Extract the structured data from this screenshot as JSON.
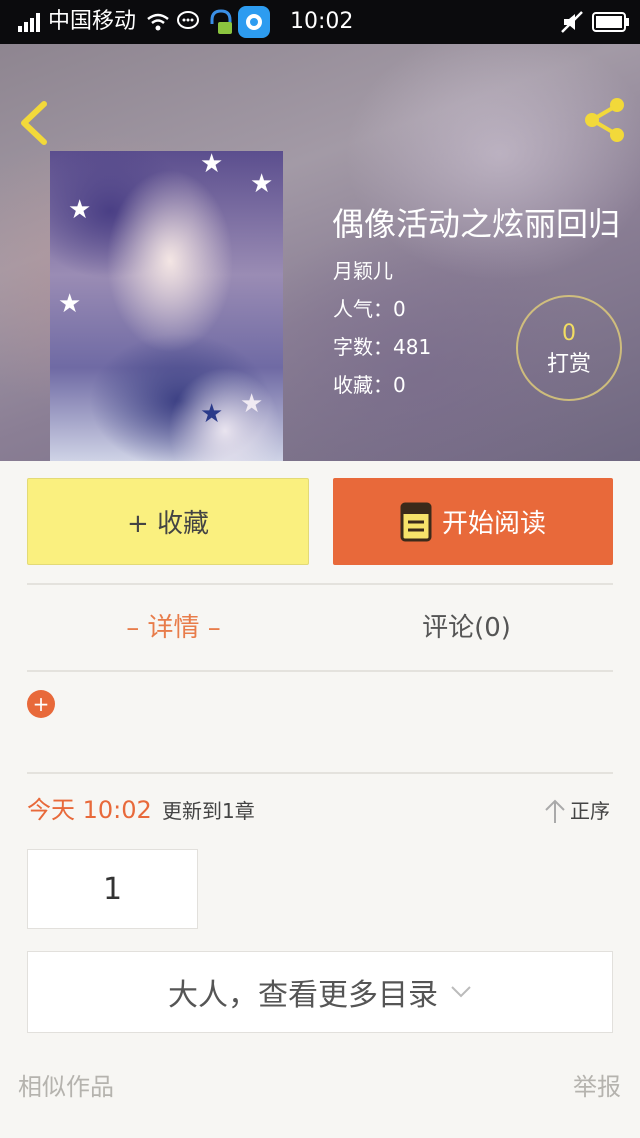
{
  "status_bar": {
    "carrier": "中国移动",
    "time": "10:02"
  },
  "book": {
    "title": "偶像活动之炫丽回归",
    "author": "月颖儿",
    "stats": [
      {
        "label": "人气",
        "value": "人气：0"
      },
      {
        "label": "字数",
        "value": "字数：481"
      },
      {
        "label": "收藏",
        "value": "收藏：0"
      }
    ],
    "reward": {
      "count": "0",
      "label": "打赏"
    }
  },
  "actions": {
    "collect_label": "+ 收藏",
    "read_label": "开始阅读"
  },
  "tabs": [
    {
      "label": "– 详情 –",
      "active": true
    },
    {
      "label": "评论(0)",
      "active": false
    }
  ],
  "expand_label": "+",
  "update": {
    "time": "今天 10:02",
    "text": "更新到1章",
    "sort_label": "正序"
  },
  "chapters": [
    "1"
  ],
  "more_catalog_label": "大人，查看更多目录",
  "footer": {
    "similar_label": "相似作品",
    "report_label": "举报"
  },
  "colors": {
    "accent": "#e8693a",
    "collect_bg": "#faf07f",
    "reward_count": "#f2dd62",
    "back_icon": "#f2d93a"
  }
}
